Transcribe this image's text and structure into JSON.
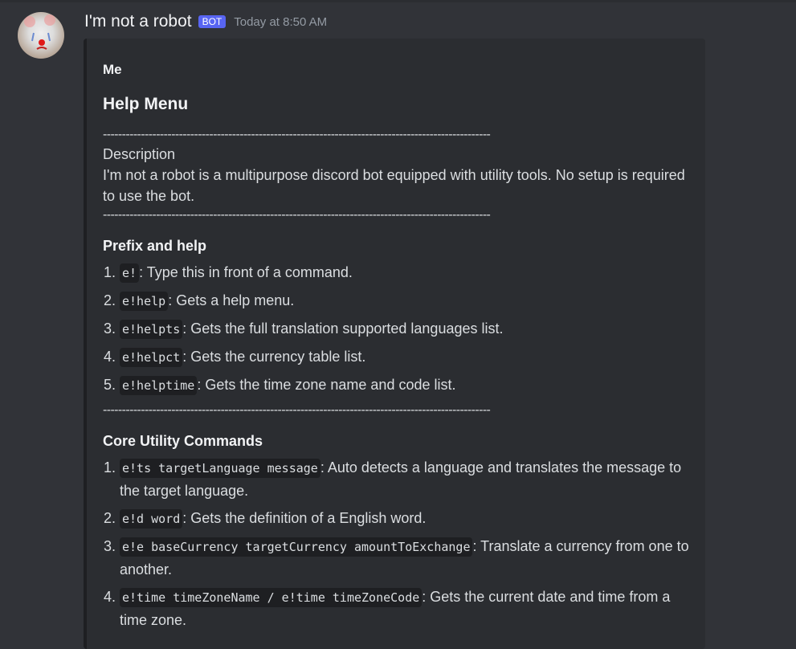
{
  "message": {
    "username": "I'm not a robot",
    "badge": "BOT",
    "timestamp": "Today at 8:50 AM"
  },
  "embed": {
    "author": "Me",
    "title": "Help Menu",
    "divider": "------------------------------------------------------------------------------------------------------",
    "description_label": "Description",
    "description": "I'm not a robot is a multipurpose discord bot equipped with utility tools. No setup is required to use the bot.",
    "prefix": {
      "heading": "Prefix and help",
      "items": [
        {
          "code": "e!",
          "text": ": Type this in front of a command."
        },
        {
          "code": "e!help",
          "text": ":  Gets a help menu."
        },
        {
          "code": "e!helpts",
          "text": ": Gets the full translation supported languages list."
        },
        {
          "code": "e!helpct",
          "text": ": Gets the currency table list."
        },
        {
          "code": "e!helptime",
          "text": ": Gets the time zone name and code list."
        }
      ]
    },
    "core": {
      "heading": "Core Utility Commands",
      "items": [
        {
          "code": "e!ts targetLanguage message",
          "text": ": Auto detects a language and translates the message to the target language."
        },
        {
          "code": "e!d word",
          "text": ": Gets the definition of a English word."
        },
        {
          "code": "e!e baseCurrency targetCurrency amountToExchange",
          "text": ": Translate a currency from one to another."
        },
        {
          "code": "e!time timeZoneName / e!time timeZoneCode",
          "text": ": Gets the current date and time from a time zone."
        }
      ]
    }
  }
}
